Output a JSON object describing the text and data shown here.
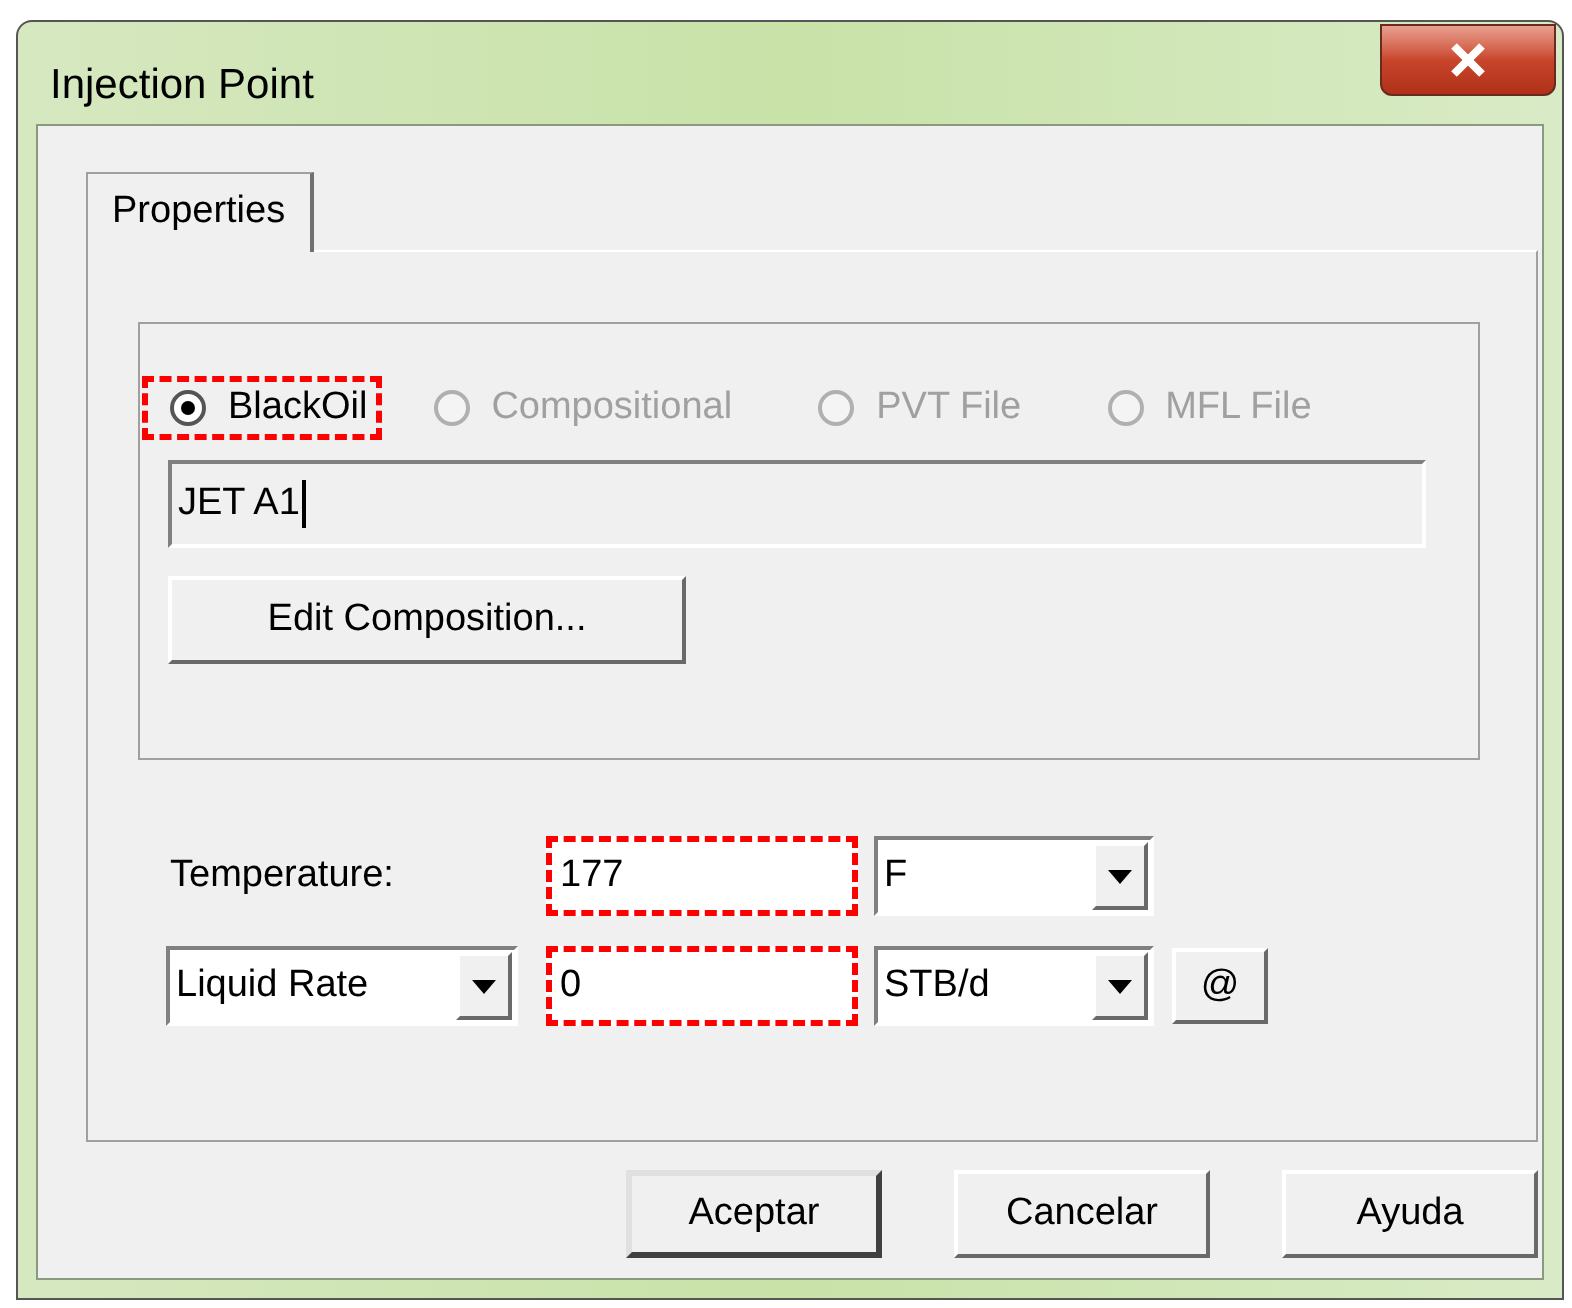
{
  "window": {
    "title": "Injection Point"
  },
  "tabs": [
    {
      "label": "Properties",
      "selected": true
    }
  ],
  "source_options": [
    {
      "label": "BlackOil",
      "selected": true,
      "disabled": false,
      "highlighted": true
    },
    {
      "label": "Compositional",
      "selected": false,
      "disabled": true,
      "highlighted": false
    },
    {
      "label": "PVT File",
      "selected": false,
      "disabled": true,
      "highlighted": false
    },
    {
      "label": "MFL File",
      "selected": false,
      "disabled": true,
      "highlighted": false
    }
  ],
  "fluid_name": {
    "value": "JET A1"
  },
  "edit_button": "Edit Composition...",
  "temperature": {
    "label": "Temperature:",
    "value": "177",
    "highlighted": true,
    "unit": "F"
  },
  "rate": {
    "type": "Liquid Rate",
    "value": "0",
    "highlighted": true,
    "unit": "STB/d",
    "at_button": "@"
  },
  "buttons": [
    {
      "label": "Aceptar",
      "default": true
    },
    {
      "label": "Cancelar",
      "default": false
    },
    {
      "label": "Ayuda",
      "default": false
    }
  ]
}
